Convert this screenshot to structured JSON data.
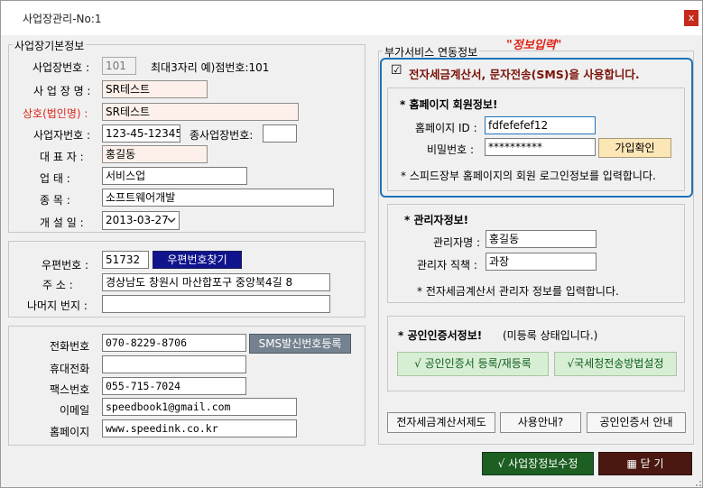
{
  "window": {
    "title": "사업장관리-No:1",
    "close_glyph": "x"
  },
  "basic_info": {
    "group_title": "사업장기본정보",
    "biz_no_label": "사업장번호 :",
    "biz_no_value": "101",
    "biz_no_hint": "최대3자리 예)점번호:101",
    "biz_name_label": "사 업 장 명 :",
    "biz_name_value": "SR테스트",
    "trade_name_label": "상호(법인명) :",
    "trade_name_value": "SR테스트",
    "reg_no_label": "사업자번호 :",
    "reg_no_value": "123-45-12345",
    "sub_biz_label": "종사업장번호:",
    "sub_biz_value": "",
    "ceo_label": "대  표  자 :",
    "ceo_value": "홍길동",
    "type_label": "업       태 :",
    "type_value": "서비스업",
    "item_label": "종       목 :",
    "item_value": "소프트웨어개발",
    "open_date_label": "개  설  일 :",
    "open_date_value": "2013-03-27"
  },
  "address": {
    "zip_label": "우편번호 :",
    "zip_value": "51732",
    "zip_search_label": "우편번호찾기",
    "addr_label": "주      소 :",
    "addr_value": "경상남도 창원시 마산합포구 중앙북4길 8",
    "rest_label": "나머지 번지 :",
    "rest_value": ""
  },
  "contact": {
    "phone_label": "전화번호",
    "phone_value": "070-8229-8706",
    "sms_btn_label": "SMS발신번호등록",
    "mobile_label": "휴대전화",
    "mobile_value": "",
    "fax_label": "팩스번호",
    "fax_value": "055-715-7024",
    "email_label": "이메일",
    "email_value": "speedbook1@gmail.com",
    "homepage_label": "홈페이지",
    "homepage_value": "www.speedink.co.kr"
  },
  "addon": {
    "group_title": "부가서비스 연동정보",
    "annotation": "\"정보입력\"",
    "use_check_label": "전자세금계산서, 문자전송(SMS)을 사용합니다.",
    "check_glyph": "☑",
    "homepage_member": {
      "title": "* 홈페이지 회원정보!",
      "id_label": "홈페이지 ID :",
      "id_value": "fdfefefef12",
      "pw_label": "비밀번호 :",
      "pw_value": "**********",
      "join_btn": "가입확인",
      "note": "* 스피드장부 홈페이지의 회원 로그인정보를 입력합니다."
    },
    "manager": {
      "title": "* 관리자정보!",
      "name_label": "관리자명 :",
      "name_value": "홍길동",
      "role_label": "관리자 직책 :",
      "role_value": "과장",
      "note": "* 전자세금계산서 관리자 정보를 입력합니다."
    },
    "cert": {
      "title": "* 공인인증서정보!",
      "status": "(미등록 상태입니다.)",
      "register_btn": "√ 공인인증서 등록/재등록",
      "nts_btn": "√국세청전송방법설정"
    },
    "bottom_buttons": {
      "tax_invoice": "전자세금계산서제도",
      "usage_guide": "사용안내?",
      "cert_guide": "공인인증서 안내"
    }
  },
  "footer": {
    "save_btn": "√  사업장정보수정",
    "close_btn": "▦  닫 기"
  },
  "colors": {
    "highlight_border": "#1e73b9",
    "annotation_red": "#e0261b",
    "dark_red_text": "#7a1208"
  }
}
